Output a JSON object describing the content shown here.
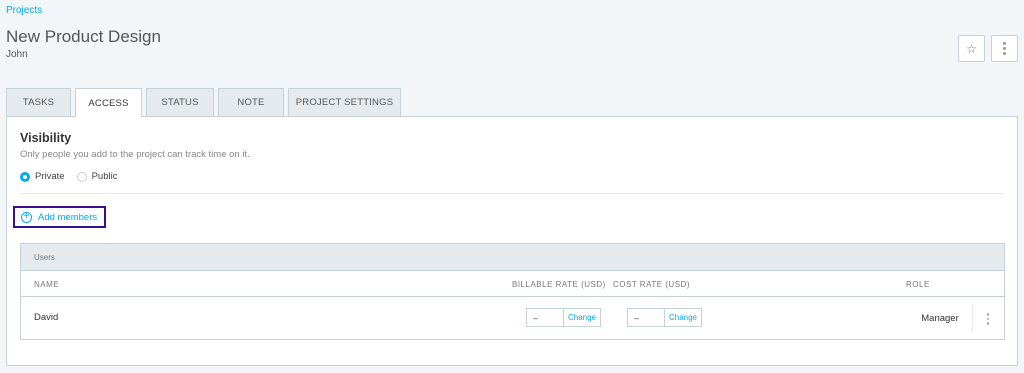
{
  "breadcrumb": "Projects",
  "project": {
    "title": "New Product Design",
    "client": "John"
  },
  "header_icons": {
    "favorite": "star-icon",
    "more": "more-vertical-icon"
  },
  "tabs": [
    {
      "label": "TASKS",
      "active": false
    },
    {
      "label": "ACCESS",
      "active": true
    },
    {
      "label": "STATUS",
      "active": false
    },
    {
      "label": "NOTE",
      "active": false
    },
    {
      "label": "PROJECT SETTINGS",
      "active": false
    }
  ],
  "visibility": {
    "title": "Visibility",
    "description": "Only people you add to the project can track time on it.",
    "options": [
      {
        "label": "Private",
        "selected": true
      },
      {
        "label": "Public",
        "selected": false
      }
    ]
  },
  "add_members_label": "Add members",
  "users_table": {
    "group_label": "Users",
    "columns": {
      "name": "NAME",
      "billable": "BILLABLE RATE (USD)",
      "cost": "COST RATE (USD)",
      "role": "ROLE"
    },
    "rows": [
      {
        "name": "David",
        "billable_rate": "–",
        "billable_change": "Change",
        "cost_rate": "–",
        "cost_change": "Change",
        "role": "Manager"
      }
    ]
  },
  "colors": {
    "accent": "#03a9f4",
    "highlight_border": "#3b0f8a"
  }
}
